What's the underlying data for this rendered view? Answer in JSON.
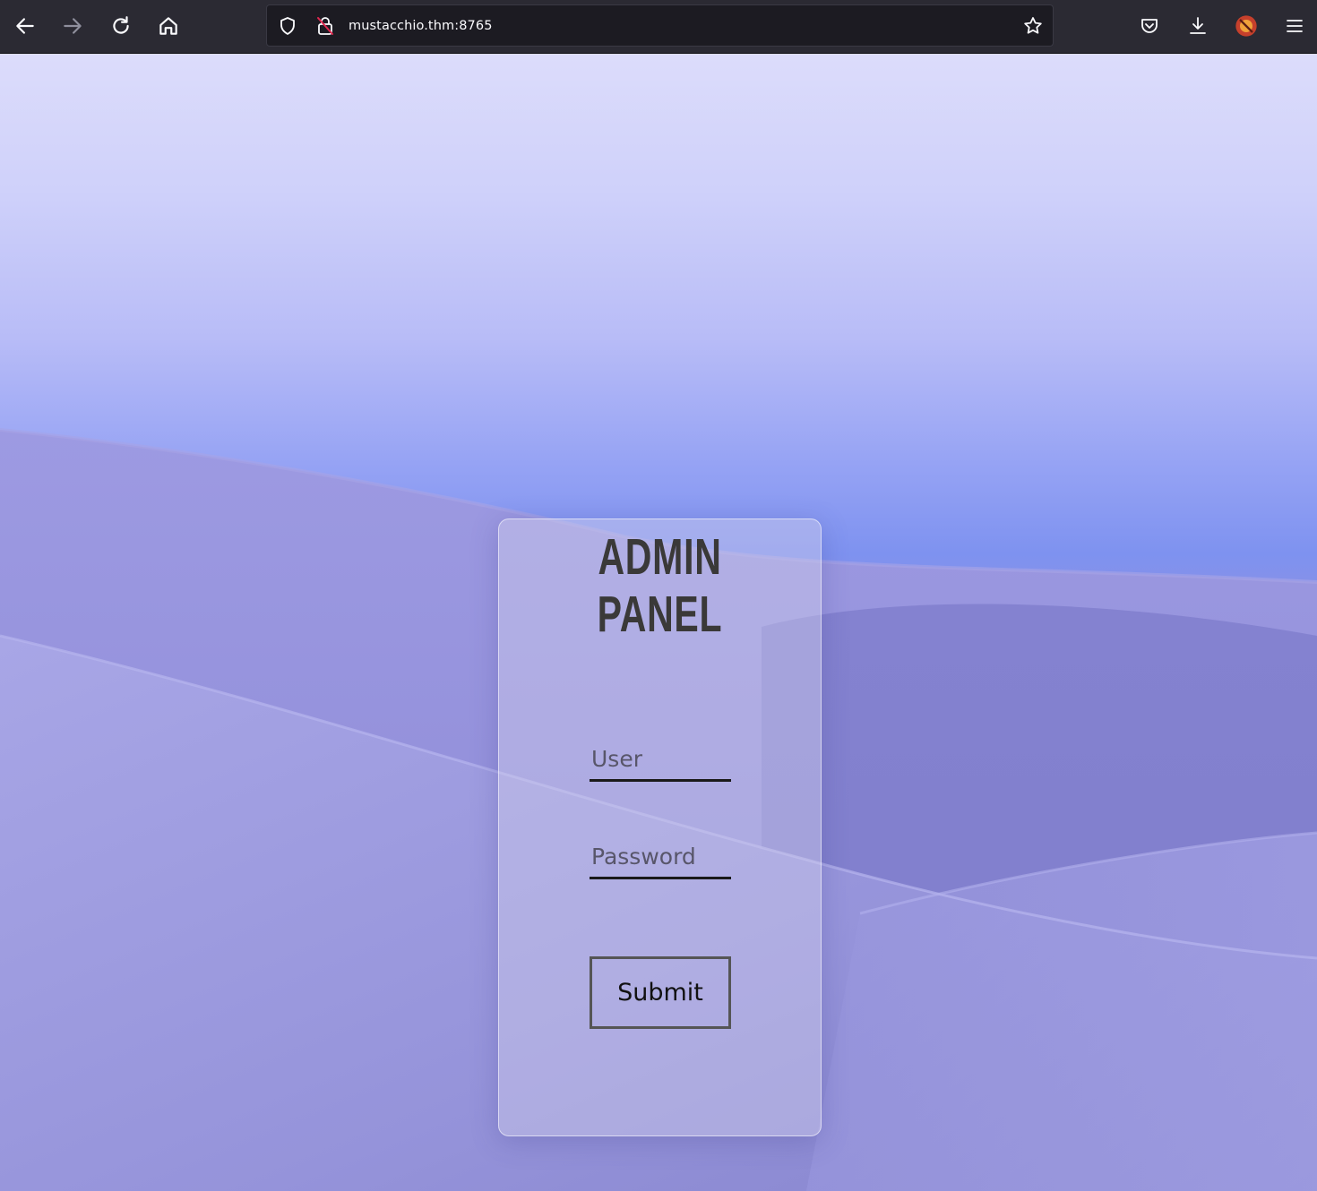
{
  "browser": {
    "url": "mustacchio.thm:8765",
    "icons": {
      "back": "back-arrow-icon",
      "forward": "forward-arrow-icon",
      "reload": "reload-icon",
      "home": "home-icon",
      "tracking_protection": "shield-icon",
      "connection_insecure": "insecure-lock-icon",
      "bookmark": "star-icon",
      "pocket": "pocket-icon",
      "downloads": "download-icon",
      "extension": "extension-icon",
      "menu": "hamburger-menu-icon"
    }
  },
  "page": {
    "title": "ADMIN PANEL",
    "form": {
      "user_placeholder": "User",
      "password_placeholder": "Password",
      "submit_label": "Submit"
    }
  },
  "colors": {
    "toolbar_bg": "#2b2a33",
    "urlbar_bg": "#1c1b22",
    "sky_top": "#dcdcfb",
    "sky_bottom": "#7e92f0",
    "dune": "#8e8cd8",
    "title_text": "#3a3938"
  }
}
